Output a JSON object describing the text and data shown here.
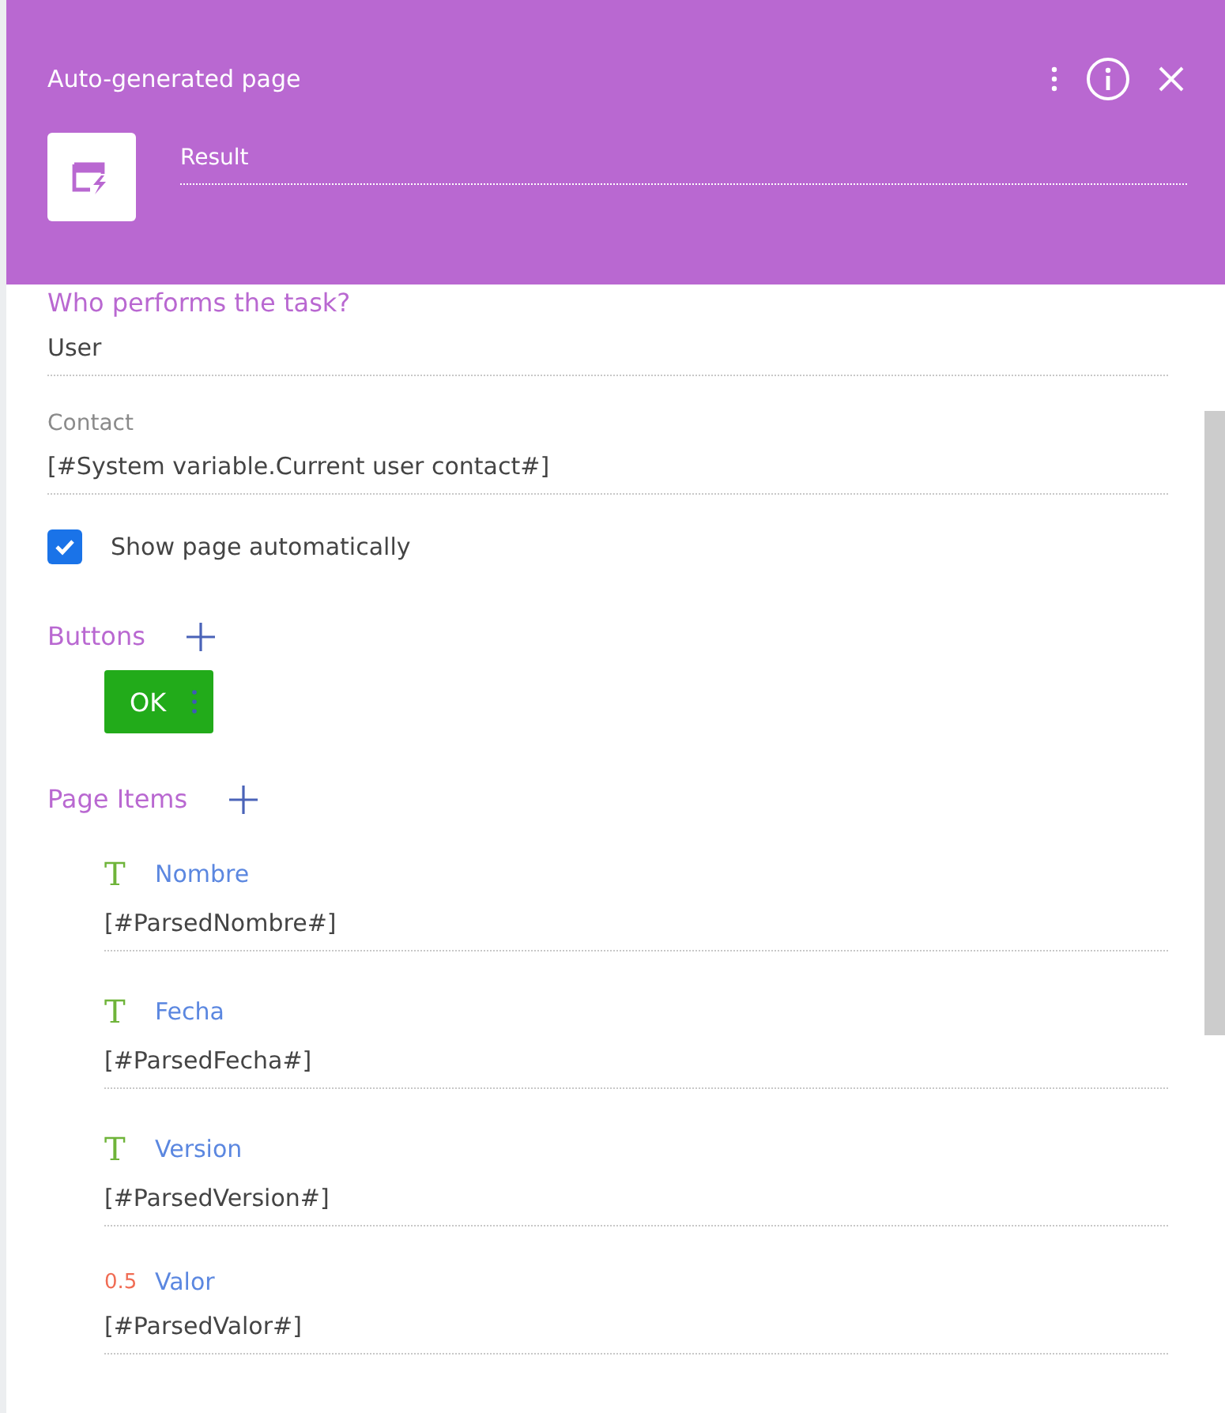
{
  "header": {
    "title": "Auto-generated page",
    "name_value": "Result"
  },
  "performer": {
    "label": "Who performs the task?",
    "value": "User"
  },
  "contact": {
    "label": "Contact",
    "value": "[#System variable.Current user contact#]"
  },
  "show_page": {
    "label": "Show page automatically",
    "checked": true
  },
  "buttons_section": {
    "label": "Buttons",
    "buttons": [
      {
        "label": "OK",
        "color": "#22ab1a"
      }
    ]
  },
  "page_items_section": {
    "label": "Page Items",
    "items": [
      {
        "kind": "text",
        "icon": "T",
        "label": "Nombre",
        "value": "[#ParsedNombre#]"
      },
      {
        "kind": "text",
        "icon": "T",
        "label": "Fecha",
        "value": "[#ParsedFecha#]"
      },
      {
        "kind": "text",
        "icon": "T",
        "label": "Version",
        "value": "[#ParsedVersion#]"
      },
      {
        "kind": "number",
        "icon": "0.5",
        "label": "Valor",
        "value": "[#ParsedValor#]"
      }
    ]
  }
}
